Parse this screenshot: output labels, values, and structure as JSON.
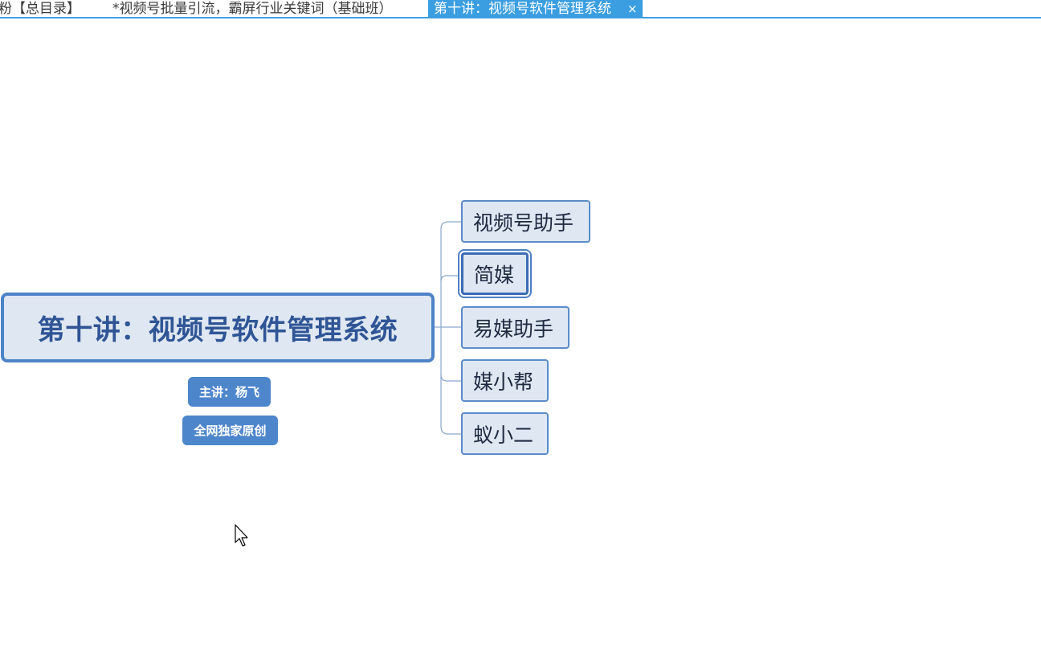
{
  "tabs": [
    {
      "label": "粉【总目录】"
    },
    {
      "label": "*视频号批量引流，霸屏行业关键词（基础班）"
    },
    {
      "label": "第十讲：视频号软件管理系统",
      "close": "×"
    }
  ],
  "mindmap": {
    "central_topic": "第十讲：视频号软件管理系统",
    "labels": [
      "主讲：杨飞",
      "全网独家原创"
    ],
    "subtopics": [
      {
        "label": "视频号助手"
      },
      {
        "label": "简媒"
      },
      {
        "label": "易媒助手"
      },
      {
        "label": "媒小帮"
      },
      {
        "label": "蚁小二"
      }
    ]
  },
  "colors": {
    "accent": "#3a9ee0",
    "central_border": "#4d83c7",
    "node_fill": "#dfe7f3",
    "label_fill": "#4e86cc"
  }
}
